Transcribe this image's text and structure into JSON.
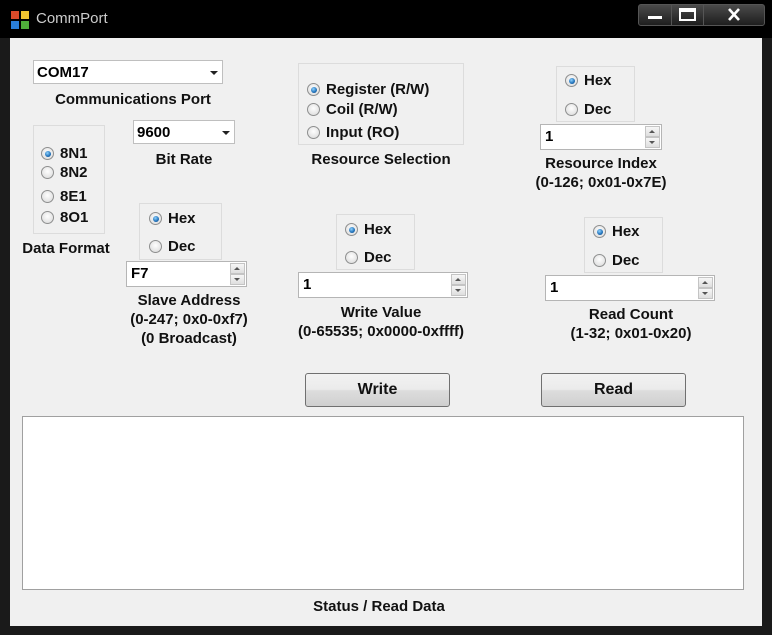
{
  "window": {
    "title": "CommPort"
  },
  "comm_port": {
    "value": "COM17",
    "label": "Communications Port"
  },
  "bit_rate": {
    "value": "9600",
    "label": "Bit Rate"
  },
  "data_format": {
    "label": "Data Format",
    "options": [
      "8N1",
      "8N2",
      "8E1",
      "8O1"
    ],
    "selected": "8N1"
  },
  "slave_address": {
    "radix": {
      "options": [
        "Hex",
        "Dec"
      ],
      "selected": "Hex"
    },
    "value": "F7",
    "label_lines": [
      "Slave Address",
      "(0-247; 0x0-0xf7)",
      "(0 Broadcast)"
    ]
  },
  "resource_selection": {
    "label": "Resource Selection",
    "options": [
      "Register (R/W)",
      "Coil (R/W)",
      "Input (RO)"
    ],
    "selected": "Register (R/W)"
  },
  "write_value": {
    "radix": {
      "options": [
        "Hex",
        "Dec"
      ],
      "selected": "Hex"
    },
    "value": "1",
    "label_lines": [
      "Write Value",
      "(0-65535; 0x0000-0xffff)"
    ]
  },
  "resource_index": {
    "radix": {
      "options": [
        "Hex",
        "Dec"
      ],
      "selected": "Hex"
    },
    "value": "1",
    "label_lines": [
      "Resource Index",
      "(0-126; 0x01-0x7E)"
    ]
  },
  "read_count": {
    "radix": {
      "options": [
        "Hex",
        "Dec"
      ],
      "selected": "Hex"
    },
    "value": "1",
    "label_lines": [
      "Read Count",
      "(1-32; 0x01-0x20)"
    ]
  },
  "buttons": {
    "write": "Write",
    "read": "Read"
  },
  "status": {
    "label": "Status / Read Data",
    "text": ""
  },
  "icons": {
    "app": "app-icon",
    "minimize": "minimize-icon",
    "maximize": "maximize-icon",
    "close": "close-icon"
  }
}
